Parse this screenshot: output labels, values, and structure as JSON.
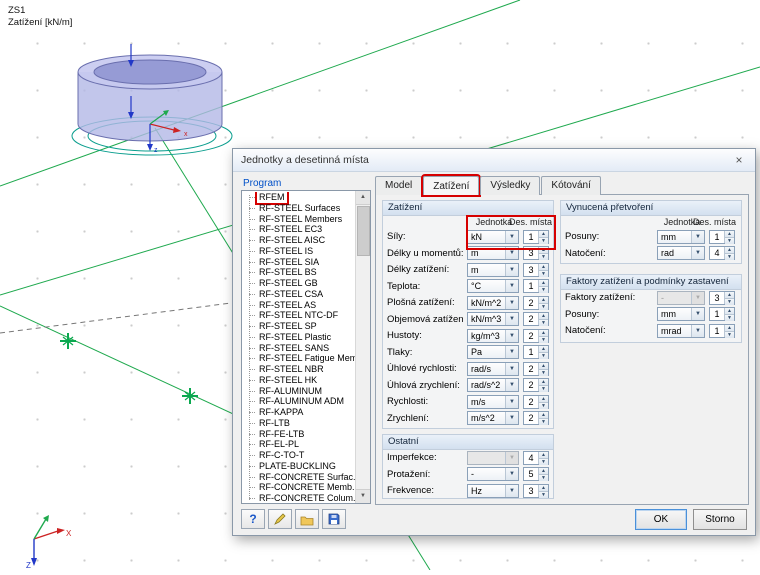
{
  "colors": {
    "annotation_red": "#d60000",
    "viewport_green": "#1fa94e",
    "model_fill": "#b6bbe8",
    "axis_x_red": "#cc2222",
    "axis_z_blue": "#2238c8"
  },
  "viewport": {
    "load_case": "ZS1",
    "load_case_label": "Zatížení [kN/m]",
    "axis_labels": {
      "x": "X",
      "z": "Z",
      "model_x": "x",
      "model_z": "z"
    }
  },
  "dialog": {
    "title": "Jednotky a desetinná místa",
    "close": "×",
    "program": {
      "label": "Program",
      "selected": "RFEM",
      "items": [
        "RFEM",
        "RF-STEEL Surfaces",
        "RF-STEEL Members",
        "RF-STEEL EC3",
        "RF-STEEL AISC",
        "RF-STEEL IS",
        "RF-STEEL SIA",
        "RF-STEEL BS",
        "RF-STEEL GB",
        "RF-STEEL CSA",
        "RF-STEEL AS",
        "RF-STEEL NTC-DF",
        "RF-STEEL SP",
        "RF-STEEL Plastic",
        "RF-STEEL SANS",
        "RF-STEEL Fatigue Mem",
        "RF-STEEL NBR",
        "RF-STEEL HK",
        "RF-ALUMINUM",
        "RF-ALUMINUM ADM",
        "RF-KAPPA",
        "RF-LTB",
        "RF-FE-LTB",
        "RF-EL-PL",
        "RF-C-TO-T",
        "PLATE-BUCKLING",
        "RF-CONCRETE Surfac...",
        "RF-CONCRETE Memb...",
        "RF-CONCRETE Colum..."
      ]
    },
    "tabs": [
      "Model",
      "Zatížení",
      "Výsledky",
      "Kótování"
    ],
    "columns": {
      "unit": "Jednotka",
      "decimals": "Des. místa"
    },
    "load_group": {
      "title": "Zatížení",
      "rows": [
        {
          "label": "Síly:",
          "unit": "kN",
          "dec": "1"
        },
        {
          "label": "Délky u momentů:",
          "unit": "m",
          "dec": "3"
        },
        {
          "label": "Délky zatížení:",
          "unit": "m",
          "dec": "3"
        },
        {
          "label": "Teplota:",
          "unit": "°C",
          "dec": "1"
        },
        {
          "label": "Plošná zatížení:",
          "unit": "kN/m^2",
          "dec": "2"
        },
        {
          "label": "Objemová zatížení:",
          "unit": "kN/m^3",
          "dec": "2"
        },
        {
          "label": "Hustoty:",
          "unit": "kg/m^3",
          "dec": "2"
        },
        {
          "label": "Tlaky:",
          "unit": "Pa",
          "dec": "1"
        },
        {
          "label": "Úhlové rychlosti:",
          "unit": "rad/s",
          "dec": "2"
        },
        {
          "label": "Úhlová zrychlení:",
          "unit": "rad/s^2",
          "dec": "2"
        },
        {
          "label": "Rychlosti:",
          "unit": "m/s",
          "dec": "2"
        },
        {
          "label": "Zrychlení:",
          "unit": "m/s^2",
          "dec": "2"
        }
      ]
    },
    "other_group": {
      "title": "Ostatní",
      "rows": [
        {
          "label": "Imperfekce:",
          "unit": "",
          "dec": "4",
          "disabled": true
        },
        {
          "label": "Protažení:",
          "unit": "-",
          "dec": "5"
        },
        {
          "label": "Frekvence:",
          "unit": "Hz",
          "dec": "3"
        }
      ]
    },
    "forced_group": {
      "title": "Vynucená přetvoření",
      "rows": [
        {
          "label": "Posuny:",
          "unit": "mm",
          "dec": "1"
        },
        {
          "label": "Natočení:",
          "unit": "rad",
          "dec": "4"
        }
      ]
    },
    "factors_group": {
      "title": "Faktory zatížení a podmínky zastavení",
      "rows": [
        {
          "label": "Faktory zatížení:",
          "unit": "-",
          "dec": "3",
          "disabled": true
        },
        {
          "label": "Posuny:",
          "unit": "mm",
          "dec": "1"
        },
        {
          "label": "Natočení:",
          "unit": "mrad",
          "dec": "1"
        }
      ]
    },
    "buttons": {
      "ok": "OK",
      "cancel": "Storno"
    }
  }
}
